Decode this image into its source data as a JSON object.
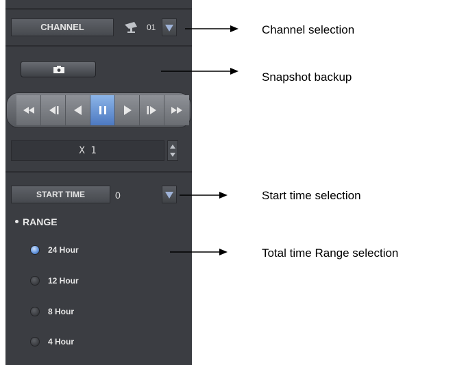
{
  "panel": {
    "channel": {
      "label": "CHANNEL",
      "value": "01"
    },
    "playback": {
      "buttons": [
        "rewind-fast",
        "step-back",
        "play-reverse",
        "pause",
        "play",
        "step-forward",
        "fast-forward"
      ],
      "active": "pause"
    },
    "speed": {
      "value": "X 1"
    },
    "start_time": {
      "label": "START TIME",
      "value": "0"
    },
    "range": {
      "title": "RANGE",
      "options": [
        {
          "label": "24  Hour",
          "selected": true
        },
        {
          "label": "12 Hour",
          "selected": false
        },
        {
          "label": "8 Hour",
          "selected": false
        },
        {
          "label": "4 Hour",
          "selected": false
        }
      ]
    }
  },
  "annotations": {
    "channel": "Channel selection",
    "snapshot": "Snapshot backup",
    "start_time": "Start time selection",
    "range": "Total time Range selection"
  },
  "colors": {
    "panel_bg": "#3b3d42",
    "accent_blue": "#5e90da"
  }
}
